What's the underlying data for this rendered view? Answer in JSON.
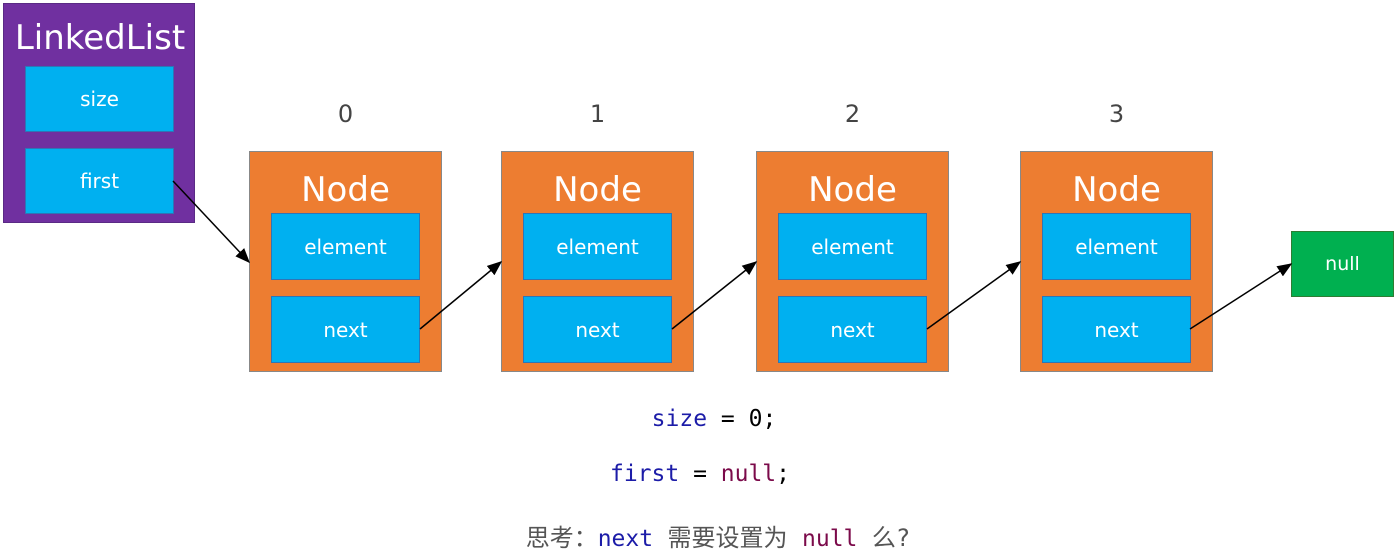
{
  "linked_list": {
    "title": "LinkedList",
    "fields": [
      "size",
      "first"
    ],
    "color": "#7030a0"
  },
  "nodes": [
    {
      "index": "0",
      "title": "Node",
      "element": "element",
      "next": "next"
    },
    {
      "index": "1",
      "title": "Node",
      "element": "element",
      "next": "next"
    },
    {
      "index": "2",
      "title": "Node",
      "element": "element",
      "next": "next"
    },
    {
      "index": "3",
      "title": "Node",
      "element": "element",
      "next": "next"
    }
  ],
  "null_box": "null",
  "code": {
    "line1": {
      "var": "size",
      "op": " = 0;"
    },
    "line2": {
      "var": "first",
      "op": " = ",
      "val": "null",
      "end": ";"
    },
    "question": {
      "prefix": "思考：",
      "kw": "next",
      "mid": " 需要设置为 ",
      "val": "null",
      "suffix": " 么?"
    }
  },
  "colors": {
    "node": "#ed7d31",
    "field": "#00b0f0",
    "null": "#00b050"
  }
}
